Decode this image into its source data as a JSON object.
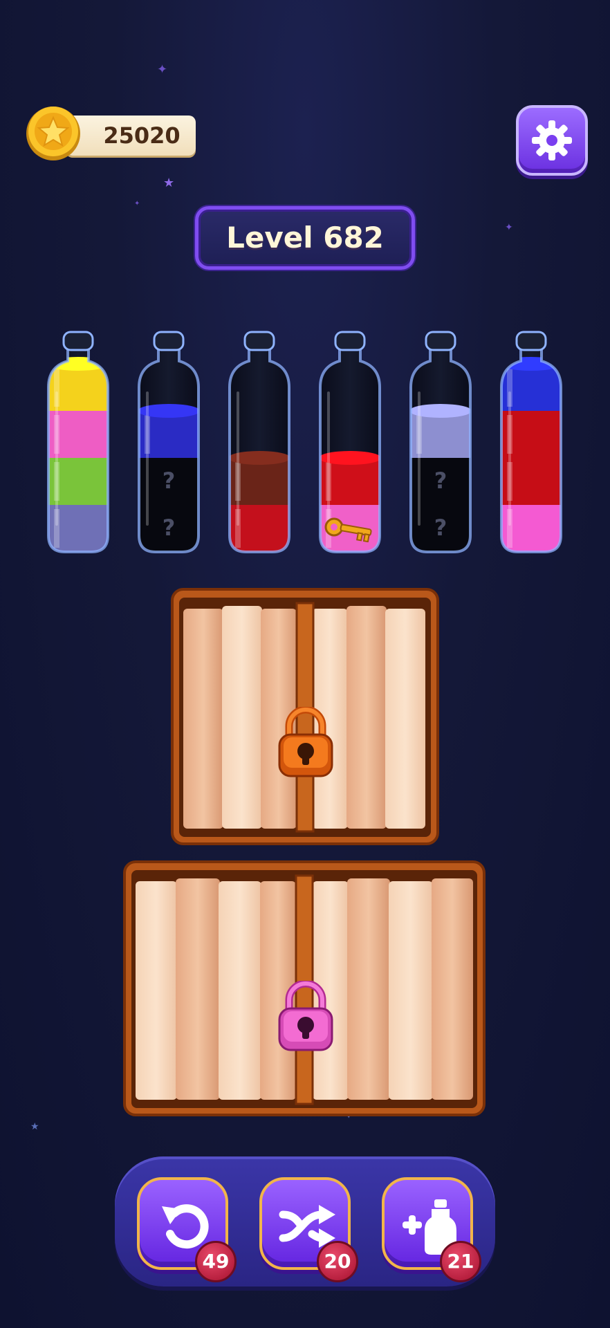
{
  "hud": {
    "coins": "25020",
    "coin_icon": "gold-star-coin-icon",
    "settings_icon": "gear-icon"
  },
  "level": {
    "label": "Level 682"
  },
  "bottles": [
    {
      "id": 1,
      "layers": [
        "#f4d21c",
        "#ee5dc4",
        "#7ac43a",
        "#6f70b6"
      ],
      "hidden": []
    },
    {
      "id": 2,
      "layers": [
        "#2a2bc4",
        "hidden",
        "hidden"
      ],
      "hidden_marks": [
        "?",
        "?"
      ]
    },
    {
      "id": 3,
      "layers": [
        "#6a2418",
        "#c4101c"
      ],
      "hidden": []
    },
    {
      "id": 4,
      "layers": [
        "#cf0f19",
        "#f060c8"
      ],
      "key_item": "golden-key-icon"
    },
    {
      "id": 5,
      "layers": [
        "#8d8fd0",
        "hidden",
        "hidden"
      ],
      "hidden_marks": [
        "?",
        "?"
      ]
    },
    {
      "id": 6,
      "layers": [
        "#2630d6",
        "#c60d16",
        "#c60d16",
        "#f45ad2"
      ],
      "hidden": []
    }
  ],
  "locked_crates": [
    {
      "id": "upper",
      "lock_color": "#f06a16",
      "lock_icon": "orange-padlock-icon"
    },
    {
      "id": "lower",
      "lock_color": "#ee5cc8",
      "lock_icon": "pink-padlock-icon"
    }
  ],
  "toolbar": {
    "undo": {
      "icon": "undo-icon",
      "count": "49"
    },
    "shuffle": {
      "icon": "shuffle-icon",
      "count": "20"
    },
    "add_bottle": {
      "icon": "add-bottle-icon",
      "count": "21"
    }
  }
}
